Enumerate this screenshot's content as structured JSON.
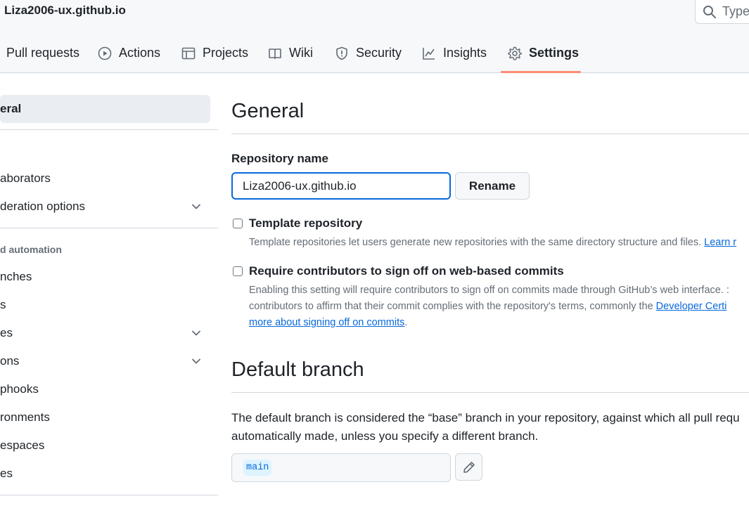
{
  "header": {
    "repo_title": "Liza2006-ux.github.io",
    "search_placeholder": "Type"
  },
  "tabs": [
    {
      "label": "Pull requests",
      "icon": "pull-request-icon"
    },
    {
      "label": "Actions",
      "icon": "play-icon"
    },
    {
      "label": "Projects",
      "icon": "table-icon"
    },
    {
      "label": "Wiki",
      "icon": "book-icon"
    },
    {
      "label": "Security",
      "icon": "shield-icon"
    },
    {
      "label": "Insights",
      "icon": "graph-icon"
    },
    {
      "label": "Settings",
      "icon": "gear-icon",
      "active": true
    }
  ],
  "sidebar": {
    "items": [
      {
        "label": "eral"
      },
      {
        "label": "aborators"
      },
      {
        "label": "deration options"
      },
      {
        "label": "nches"
      },
      {
        "label": "s"
      },
      {
        "label": "es"
      },
      {
        "label": "ons"
      },
      {
        "label": "phooks"
      },
      {
        "label": "ronments"
      },
      {
        "label": "espaces"
      },
      {
        "label": "es"
      }
    ],
    "heading": "d automation"
  },
  "main": {
    "general_title": "General",
    "repo_name_label": "Repository name",
    "repo_name_value": "Liza2006-ux.github.io",
    "rename_button": "Rename",
    "template": {
      "title": "Template repository",
      "desc": "Template repositories let users generate new repositories with the same directory structure and files.",
      "link": "Learn r"
    },
    "signoff": {
      "title": "Require contributors to sign off on web-based commits",
      "line1": "Enabling this setting will require contributors to sign off on commits made through GitHub’s web interface. :",
      "line2": "contributors to affirm that their commit complies with the repository's terms, commonly the",
      "line2_link": "Developer Certi",
      "line3_link": "more about signing off on commits",
      "line3_end": "."
    },
    "default_branch": {
      "title": "Default branch",
      "line1": "The default branch is considered the “base” branch in your repository, against which all pull requ",
      "line2": "automatically made, unless you specify a different branch.",
      "branch": "main"
    }
  },
  "colors": {
    "accent": "#0969da",
    "tab_underline": "#fd8c73",
    "border": "#d0d7de"
  }
}
